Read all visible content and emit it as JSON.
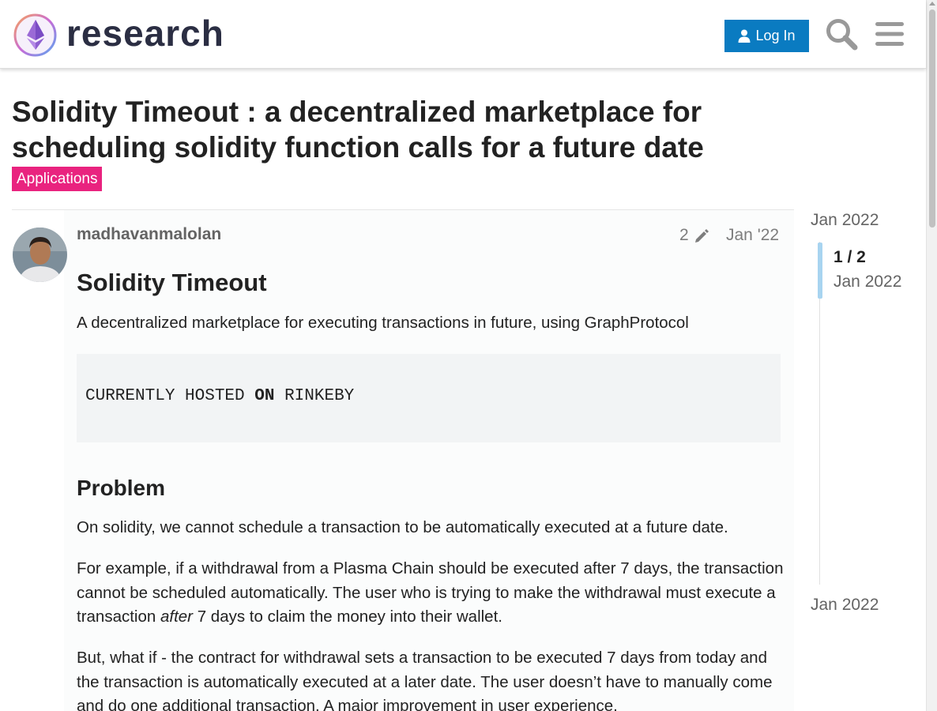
{
  "header": {
    "logo_text": "research",
    "login_label": "Log In"
  },
  "topic": {
    "title": "Solidity Timeout : a decentralized marketplace for scheduling solidity function calls for a future date",
    "category": "Applications",
    "category_color": "#e9237f"
  },
  "post": {
    "username": "madhavanmalolan",
    "edit_count": "2",
    "date": "Jan '22",
    "heading": "Solidity Timeout",
    "lead": "A decentralized marketplace for executing transactions in future, using GraphProtocol",
    "code": {
      "before": "CURRENTLY HOSTED ",
      "bold": "ON",
      "after": " RINKEBY"
    },
    "problem_heading": "Problem",
    "p1": "On solidity, we cannot schedule a transaction to be automatically executed at a future date.",
    "p2_before": "For example, if a withdrawal from a Plasma Chain should be executed after 7 days, the transaction cannot be scheduled automatically. The user who is trying to make the withdrawal must execute a transaction ",
    "p2_em": "after",
    "p2_after": " 7 days to claim the money into their wallet.",
    "p3": "But, what if - the contract for withdrawal sets a transaction to be executed 7 days from today and the transaction is automatically executed at a later date. The user doesn’t have to manually come and do one additional transaction. A major improvement in user experience."
  },
  "timeline": {
    "start": "Jan 2022",
    "position": "1 / 2",
    "position_date": "Jan 2022",
    "end": "Jan 2022"
  },
  "colors": {
    "accent": "#0a7bc1",
    "timeline_handle": "#a8d4f0"
  },
  "icons": [
    "user-icon",
    "search-icon",
    "hamburger-menu-icon",
    "pencil-icon",
    "ethereum-logo-icon"
  ]
}
